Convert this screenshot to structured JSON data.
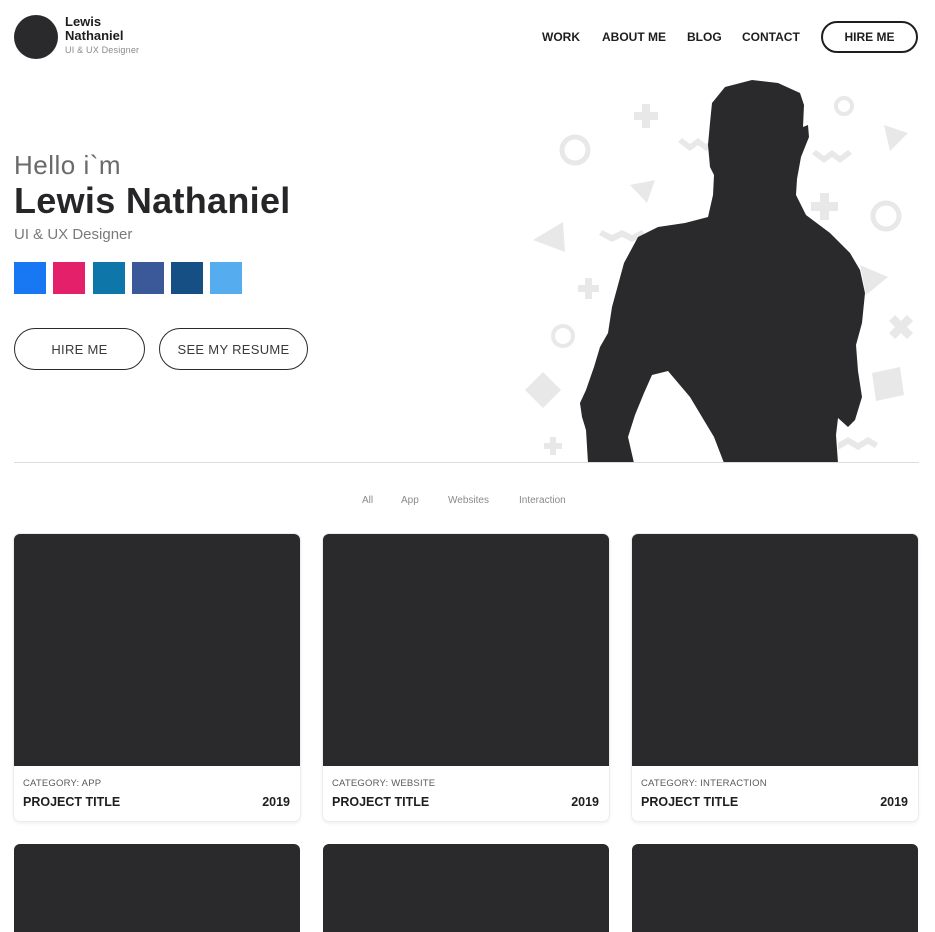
{
  "brand": {
    "name": "Lewis Nathaniel",
    "role": "UI & UX Designer"
  },
  "nav": {
    "items": [
      "WORK",
      "ABOUT ME",
      "BLOG",
      "CONTACT"
    ],
    "cta": "HIRE ME"
  },
  "hero": {
    "greeting": "Hello i`m",
    "name": "Lewis Nathaniel",
    "role": "UI & UX Designer",
    "socials": [
      {
        "icon": "facebook-icon",
        "glyph": "",
        "color": "#1877f2"
      },
      {
        "icon": "instagram-icon",
        "glyph": "",
        "color": "#e4206b"
      },
      {
        "icon": "linkedin-icon",
        "glyph": "",
        "color": "#0e76a8"
      },
      {
        "icon": "facebook-alt-icon",
        "glyph": "",
        "color": "#3b5998"
      },
      {
        "icon": "tumblr-icon",
        "glyph": "",
        "color": "#154f84"
      },
      {
        "icon": "twitter-icon",
        "glyph": "",
        "color": "#55acee"
      }
    ],
    "buttons": {
      "hire": "HIRE ME",
      "resume": "SEE MY RESUME"
    }
  },
  "filters": [
    "All",
    "App",
    "Websites",
    "Interaction"
  ],
  "projects": [
    {
      "category": "CATEGORY: APP",
      "title": "PROJECT TITLE",
      "year": "2019"
    },
    {
      "category": "CATEGORY: WEBSITE",
      "title": "PROJECT TITLE",
      "year": "2019"
    },
    {
      "category": "CATEGORY: INTERACTION",
      "title": "PROJECT TITLE",
      "year": "2019"
    }
  ],
  "colors": {
    "dark": "#2a2a2c",
    "divider": "#dcdcdc",
    "shapes": "#e8e8e8"
  }
}
